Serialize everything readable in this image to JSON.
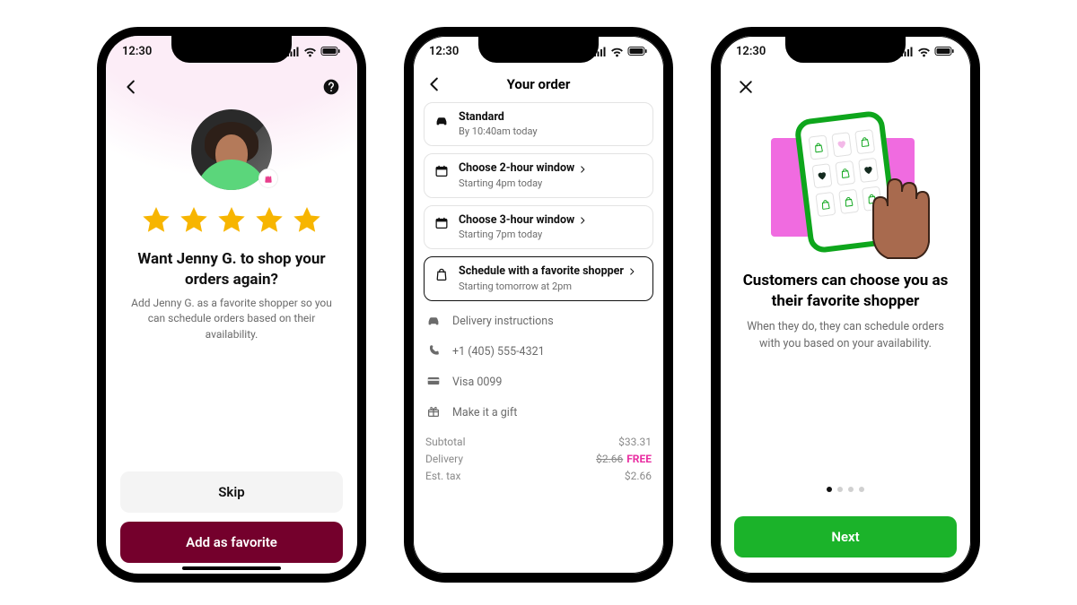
{
  "status": {
    "time": "12:30"
  },
  "phone1": {
    "heading": "Want Jenny G. to shop your orders again?",
    "sub": "Add Jenny G. as a favorite shopper so you can schedule orders based on their availability.",
    "skip": "Skip",
    "add": "Add as favorite",
    "rating": 5
  },
  "phone2": {
    "title": "Your order",
    "options": {
      "standard": {
        "title": "Standard",
        "sub": "By 10:40am today"
      },
      "two": {
        "title": "Choose 2-hour window",
        "sub": "Starting 4pm today"
      },
      "three": {
        "title": "Choose 3-hour window",
        "sub": "Starting 7pm today"
      },
      "fav": {
        "title": "Schedule with a favorite shopper",
        "sub": "Starting tomorrow at 2pm"
      }
    },
    "rows": {
      "instructions": "Delivery instructions",
      "phone": "+1 (405) 555-4321",
      "card": "Visa 0099",
      "gift": "Make it a gift"
    },
    "totals": {
      "subtotal_label": "Subtotal",
      "subtotal": "$33.31",
      "delivery_label": "Delivery",
      "delivery_strike": "$2.66",
      "delivery_free": "FREE",
      "tax_label": "Est. tax",
      "tax": "$2.66"
    }
  },
  "phone3": {
    "heading": "Customers can choose you as their favorite shopper",
    "sub": "When they do, they can schedule orders with you based on your availability.",
    "next": "Next",
    "page_index": 0,
    "page_count": 4
  }
}
